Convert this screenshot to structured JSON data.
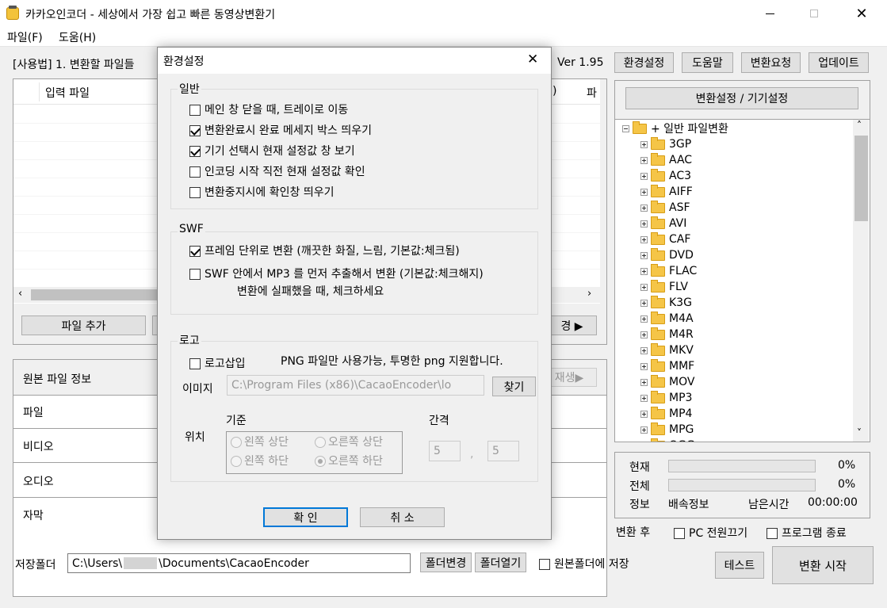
{
  "window": {
    "title": "카카오인코더 - 세상에서 가장 쉽고 빠른 동영상변환기",
    "menu": [
      "파일(F)",
      "도움(H)"
    ]
  },
  "toolbar": {
    "usage": "[사용법] 1. 변환할 파일들",
    "version": "Ver 1.95",
    "buttons": [
      "환경설정",
      "도움말",
      "변환요청",
      "업데이트"
    ]
  },
  "file_list": {
    "col_input": "입력 파일",
    "col_right1": ")",
    "col_right2": "파",
    "add_button": "파일 추가",
    "play_button": "경 ▶"
  },
  "source_info": {
    "title": "원본 파일 정보",
    "play_button": "재생▶",
    "rows": [
      "파일",
      "비디오",
      "오디오",
      "자막"
    ]
  },
  "settings_panel": {
    "header_button": "변환설정 / 기기설정",
    "tree_root": "+ 일반 파일변환",
    "tree_items": [
      "3GP",
      "AAC",
      "AC3",
      "AIFF",
      "ASF",
      "AVI",
      "CAF",
      "DVD",
      "FLAC",
      "FLV",
      "K3G",
      "M4A",
      "M4R",
      "MKV",
      "MMF",
      "MOV",
      "MP3",
      "MP4",
      "MPG",
      "OGG"
    ]
  },
  "progress": {
    "current_label": "현재",
    "current_value": "0%",
    "current_fraction": 0,
    "total_label": "전체",
    "total_value": "0%",
    "total_fraction": 0,
    "info_label": "정보",
    "info_value": "배속정보",
    "remain_label": "남은시간",
    "remain_value": "00:00:00"
  },
  "after": {
    "label": "변환 후",
    "pc_off": "PC 전원끄기",
    "quit": "프로그램 종료"
  },
  "bottom": {
    "folder_label": "저장폴더",
    "folder_prefix": "C:\\Users\\",
    "folder_suffix": "\\Documents\\CacaoEncoder",
    "change_button": "폴더변경",
    "open_button": "폴더열기",
    "save_original": "원본폴더에 저장",
    "test_button": "테스트",
    "start_button": "변환 시작"
  },
  "dialog": {
    "title": "환경설정",
    "general": {
      "label": "일반",
      "options": [
        {
          "text": "메인 창 닫을 때, 트레이로 이동",
          "checked": false
        },
        {
          "text": "변환완료시 완료 메세지 박스 띄우기",
          "checked": true
        },
        {
          "text": "기기 선택시 현재 설정값 창 보기",
          "checked": true
        },
        {
          "text": "인코딩 시작 직전 현재 설정값 확인",
          "checked": false
        },
        {
          "text": "변환중지시에 확인창 띄우기",
          "checked": false
        }
      ]
    },
    "swf": {
      "label": "SWF",
      "opt1": "프레임 단위로 변환 (깨끗한 화질, 느림, 기본값:체크됨)",
      "opt1_checked": true,
      "opt2": "SWF 안에서 MP3 를 먼저 추출해서 변환 (기본값:체크해지)",
      "opt2_checked": false,
      "opt2_note": "변환에 실패했을 때, 체크하세요"
    },
    "logo": {
      "label": "로고",
      "insert": "로고삽입",
      "insert_checked": false,
      "note": "PNG 파일만 사용가능, 투명한 png 지원합니다.",
      "image_label": "이미지",
      "image_path": "C:\\Program Files (x86)\\CacaoEncoder\\lo",
      "find_button": "찾기",
      "position_label": "위치",
      "base_label": "기준",
      "gap_label": "간격",
      "positions": [
        "왼쪽 상단",
        "오른쪽 상단",
        "왼쪽 하단",
        "오른쪽 하단"
      ],
      "selected_position": "오른쪽 하단",
      "gap_x": "5",
      "gap_y": "5",
      "gap_sep": ","
    },
    "ok_button": "확 인",
    "cancel_button": "취 소"
  }
}
